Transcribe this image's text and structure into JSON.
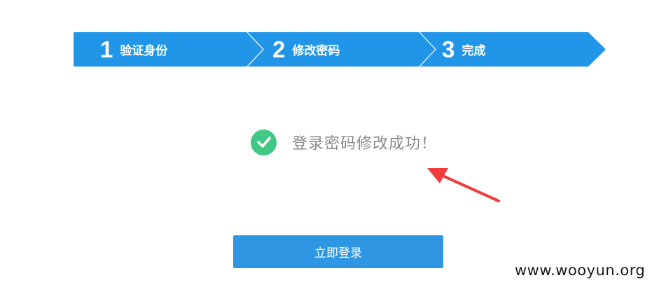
{
  "steps": [
    {
      "num": "1",
      "label": "验证身份"
    },
    {
      "num": "2",
      "label": "修改密码"
    },
    {
      "num": "3",
      "label": "完成"
    }
  ],
  "result": {
    "message": "登录密码修改成功！",
    "icon": "check-circle-icon",
    "icon_color": "#41c885"
  },
  "login_button": {
    "label": "立即登录"
  },
  "watermark": "www.wooyun.org",
  "colors": {
    "step_bar": "#2196e8",
    "button": "#2f96e3",
    "annotation_arrow": "#f03c3c"
  }
}
